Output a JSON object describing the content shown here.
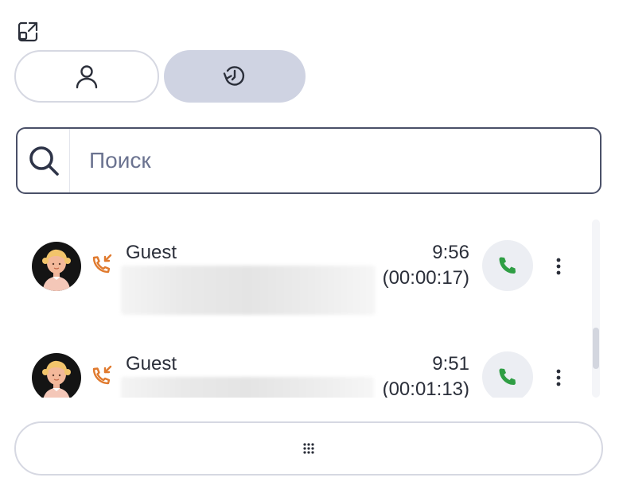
{
  "tabs": {
    "contacts_icon": "person-icon",
    "history_icon": "history-icon",
    "active": "history"
  },
  "search": {
    "placeholder": "Поиск",
    "value": ""
  },
  "calls": [
    {
      "name": "Guest",
      "time": "9:56",
      "duration": "(00:00:17)",
      "direction": "incoming"
    },
    {
      "name": "Guest",
      "time": "9:51",
      "duration": "(00:01:13)",
      "direction": "incoming"
    }
  ],
  "colors": {
    "accent_call": "#2f9e44",
    "incoming_arrow": "#e07a2e",
    "active_tab": "#cfd3e2",
    "border": "#d6d8e2"
  },
  "icons": {
    "popout": "popout-icon",
    "search": "search-icon",
    "call": "phone-icon",
    "more": "more-vertical-icon",
    "dialpad": "dialpad-icon"
  }
}
